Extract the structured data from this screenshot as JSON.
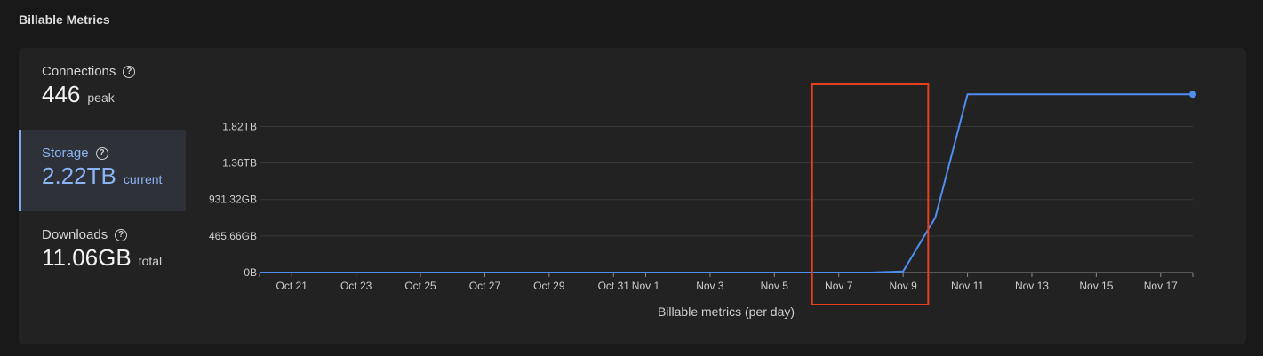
{
  "section_title": "Billable Metrics",
  "metrics": [
    {
      "label": "Connections",
      "value": "446",
      "unit": "peak",
      "selected": false
    },
    {
      "label": "Storage",
      "value": "2.22TB",
      "unit": "current",
      "selected": true
    },
    {
      "label": "Downloads",
      "value": "11.06GB",
      "unit": "total",
      "selected": false
    }
  ],
  "help_glyph": "?",
  "colors": {
    "line": "#4f8df0",
    "highlight": "#e8401c",
    "selected": "#8ab4f8"
  },
  "chart_data": {
    "type": "line",
    "xlabel": "Billable metrics (per day)",
    "ylabel": "",
    "y_tick_labels": [
      "0B",
      "465.66GB",
      "931.32GB",
      "1.36TB",
      "1.82TB"
    ],
    "y_tick_values_gb": [
      0,
      465.66,
      931.32,
      1396.98,
      1862.64
    ],
    "ylim_gb": [
      0,
      2400
    ],
    "x_tick_labels": [
      "Oct 21",
      "Oct 23",
      "Oct 25",
      "Oct 27",
      "Oct 29",
      "Oct 31",
      "Nov 1",
      "Nov 3",
      "Nov 5",
      "Nov 7",
      "Nov 9",
      "Nov 11",
      "Nov 13",
      "Nov 15",
      "Nov 17"
    ],
    "x_tick_dates": [
      "2023-10-21",
      "2023-10-23",
      "2023-10-25",
      "2023-10-27",
      "2023-10-29",
      "2023-10-31",
      "2023-11-01",
      "2023-11-03",
      "2023-11-05",
      "2023-11-07",
      "2023-11-09",
      "2023-11-11",
      "2023-11-13",
      "2023-11-15",
      "2023-11-17"
    ],
    "xlim": [
      "2023-10-20",
      "2023-11-18"
    ],
    "grid": true,
    "series": [
      {
        "x": [
          "2023-10-20",
          "2023-11-08",
          "2023-11-09",
          "2023-11-10",
          "2023-11-11",
          "2023-11-18"
        ],
        "y_gb": [
          0,
          0,
          15,
          700,
          2273,
          2273
        ]
      }
    ],
    "highlight_range": [
      "2023-11-07",
      "2023-11-10"
    ]
  }
}
